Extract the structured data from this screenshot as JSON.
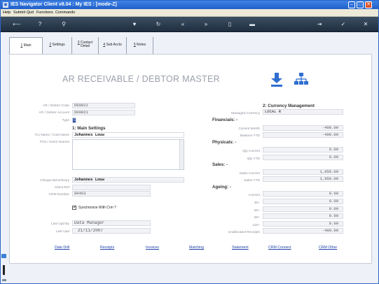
{
  "window": {
    "title": "IES Navigator Client v8.04 : My IES :      [mode-Z]",
    "app_icon": "app-icon"
  },
  "menu": [
    "Help",
    "Submit",
    "Quit",
    "Functions",
    "Commands"
  ],
  "toolbar_icons": [
    "back-arrow-icon",
    "help-icon",
    "search-icon",
    "heart-icon",
    "refresh-icon",
    "rewind-icon",
    "fast-forward-icon",
    "document-icon",
    "trash-icon",
    "exit-icon",
    "check-icon",
    "close-icon"
  ],
  "tabs": [
    {
      "num": "1",
      "label": "Main"
    },
    {
      "num": "2",
      "label": "Settings"
    },
    {
      "num": "3",
      "label": "Contact",
      "label2": "Detail"
    },
    {
      "num": "4",
      "label": "Sub Accts"
    },
    {
      "num": "5",
      "label": "Notes"
    }
  ],
  "heading": "AR RECEIVABLE / DEBTOR MASTER",
  "left": {
    "debtor_code_label": "AR / Debtor Code",
    "debtor_code": "D00021",
    "debtor_account_label": "AR / Debtor Account",
    "debtor_account": "D00021",
    "type_label": "Type",
    "type": "C",
    "main_settings": "1: Main Settings",
    "co_name_label": "*Co Name / Cust Name",
    "co_name": "Johannes Louw",
    "first_names_label": "First / Given Names",
    "cheque_beneficiary_label": "Cheque Beneficiary",
    "cheque_beneficiary": "Johannes Louw",
    "client_ref_label": "Client Ref",
    "client_ref": "",
    "crm_number_label": "CRM Number",
    "crm_number": "00463",
    "sync_label": "Synchronize With Crm ?",
    "sync_checked": "✓",
    "last_upd_by_label": "Last Upd By",
    "last_upd_by": "Data Manager",
    "last_upd_label": "Last Upd",
    "last_upd": "21/11/2007"
  },
  "right": {
    "currency_mgmt": "2: Currency Management",
    "managed_currency_label": "Managed Currency",
    "managed_currency": "LOCAL R",
    "financials": "Financials: -",
    "current_month_label": "Current Month",
    "current_month": "-400.00",
    "balance_ytd_label": "Balance YTD",
    "balance_ytd": "-400.00",
    "physicals": "Physicals: -",
    "qty_current_label": "Qty Current",
    "qty_current": "0.00",
    "qty_ytd_label": "Qty YTD",
    "qty_ytd": "0.00",
    "sales": "Sales: -",
    "sales_current_label": "Sales Current",
    "sales_current": "1,850.00",
    "sales_ytd_label": "Sales YTD",
    "sales_ytd": "1,850.00",
    "ageing": "Ageing: -",
    "ageing_current_label": "Current",
    "ageing_current": "0.00",
    "ageing_30_label": "30+",
    "ageing_30": "0.00",
    "ageing_60_label": "60+",
    "ageing_60": "0.00",
    "ageing_90_label": "90+",
    "ageing_90": "0.00",
    "ageing_120_label": "120+",
    "ageing_120": "0.00",
    "unallocated_label": "Unallocated Receipts",
    "unallocated": "-400.00"
  },
  "links": [
    "Date Drill",
    "Receipts",
    "Invoices",
    "Matching",
    "Statement",
    "CRM Connect",
    "CRM Other"
  ],
  "colors": {
    "titlebar": "#1f5fc8",
    "toolbar": "#2b3b4e",
    "link": "#2244aa",
    "download_icon": "#2f6fd0"
  }
}
